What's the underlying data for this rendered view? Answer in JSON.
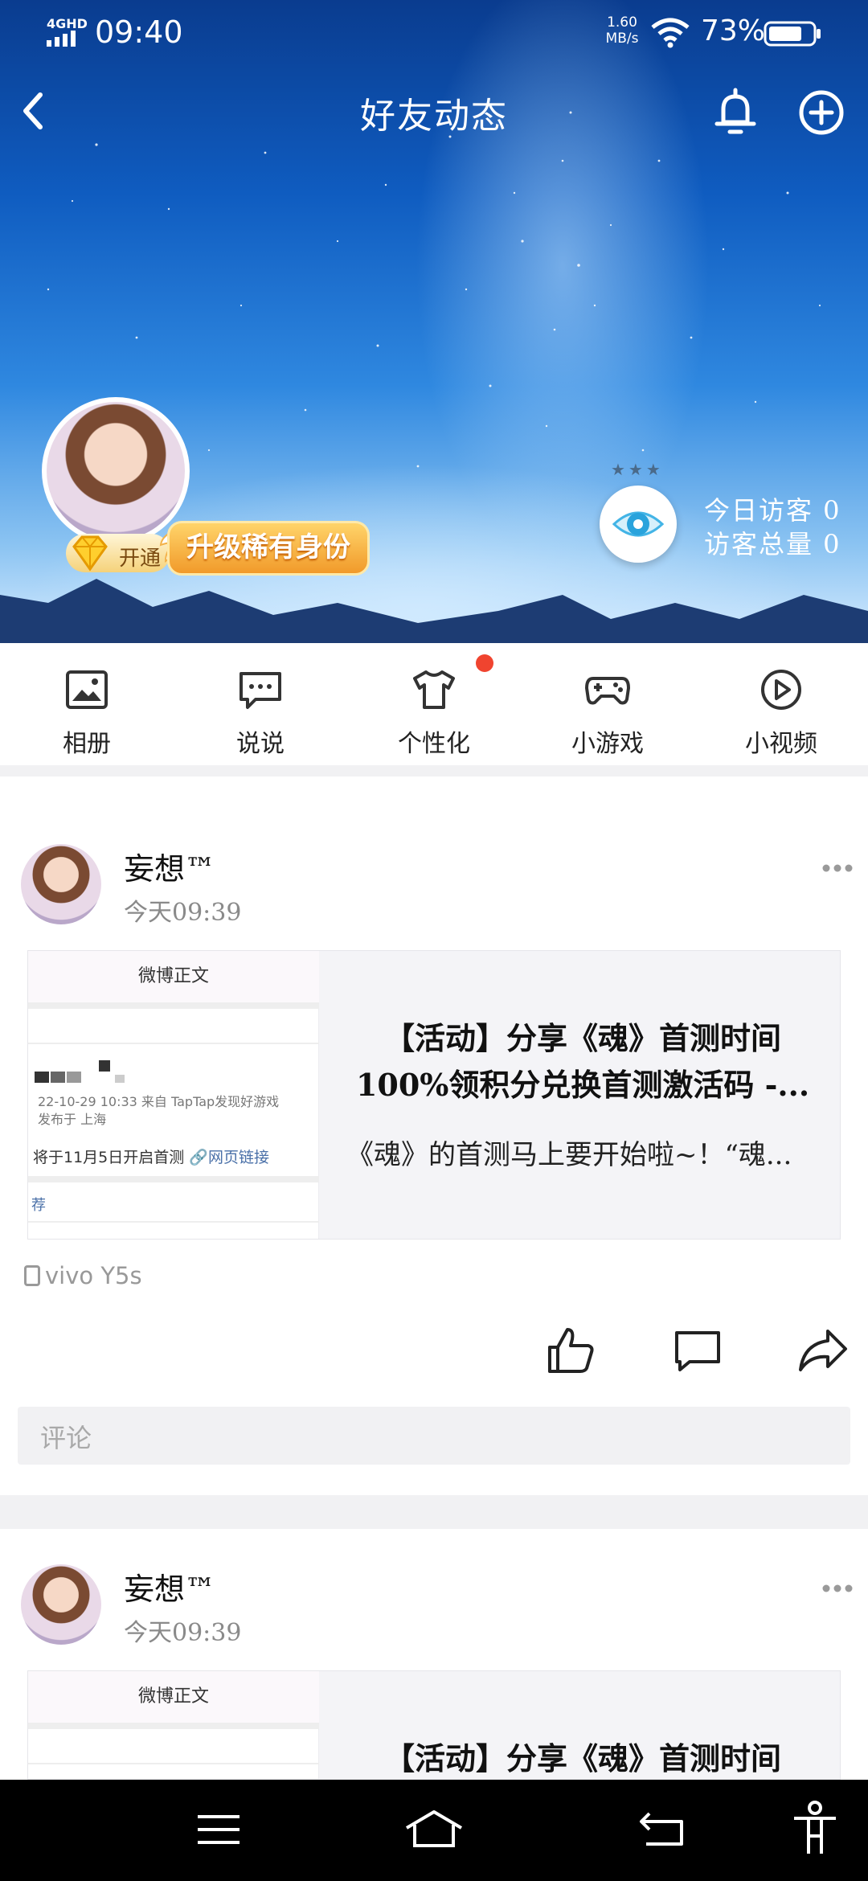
{
  "status_bar": {
    "network": "4GHD",
    "time": "09:40",
    "speed_value": "1.60",
    "speed_unit": "MB/s",
    "battery": "73%"
  },
  "nav": {
    "title": "好友动态",
    "back_icon": "back-arrow-icon",
    "bell_icon": "bell-icon",
    "add_icon": "plus-circle-icon"
  },
  "profile": {
    "vip_open": "开通",
    "upgrade_label": "升级稀有身份",
    "visitors_today": "今日访客 0",
    "visitors_total": "访客总量 0"
  },
  "shortcuts": [
    {
      "label": "相册",
      "icon": "photo-album-icon"
    },
    {
      "label": "说说",
      "icon": "chat-bubble-icon"
    },
    {
      "label": "个性化",
      "icon": "tshirt-icon",
      "badge": true
    },
    {
      "label": "小游戏",
      "icon": "gamepad-icon"
    },
    {
      "label": "小视频",
      "icon": "play-circle-icon"
    }
  ],
  "posts": [
    {
      "author": "妄想™",
      "time": "今天09:39",
      "thumb": {
        "header": "微博正文",
        "meta1": "22-10-29 10:33  来自 TapTap发现好游戏",
        "meta2": "发布于 上海",
        "line": "将于11月5日开启首测",
        "link": "🔗网页链接",
        "rec": "荐"
      },
      "title_line1": "【活动】分享《魂》首测时间",
      "title_line2": "100%领积分兑换首测激活码 -...",
      "description": "《魂》的首测马上要开始啦~！“魂...",
      "device": "vivo Y5s",
      "comment_placeholder": "评论"
    },
    {
      "author": "妄想™",
      "time": "今天09:39",
      "thumb": {
        "header": "微博正文"
      },
      "title_line1": "【活动】分享《魂》首测时间"
    }
  ],
  "colors": {
    "badge_red": "#f0442f",
    "upgrade_orange": "#f19a2a",
    "separator": "#f1f1f3"
  }
}
